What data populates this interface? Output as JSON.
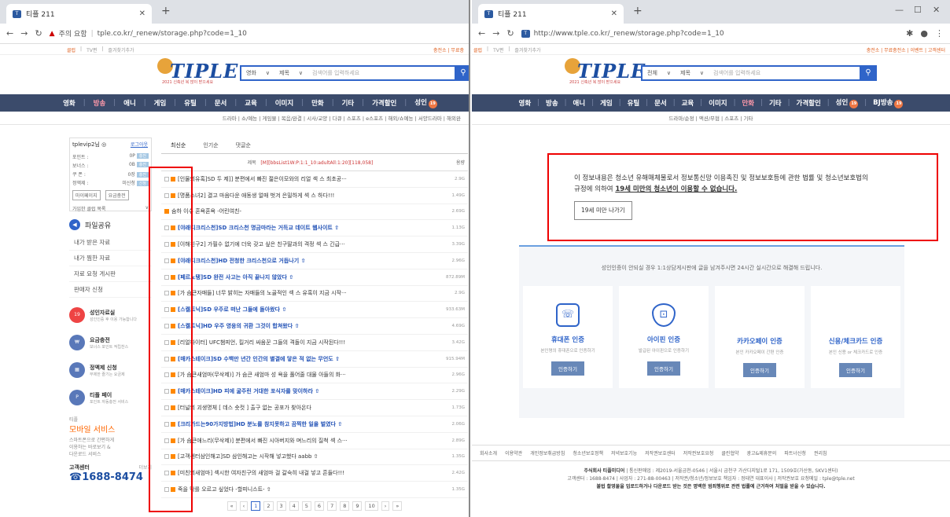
{
  "left_window": {
    "tab_title": "티플 211",
    "url_warning": "주의 요함",
    "url": "tple.co.kr/_renew/storage.php?code=1_10",
    "bookmarks": [
      "클럽",
      "TV편",
      "즐겨찾기추가"
    ],
    "bookmark_right": "충전소 | 무료충",
    "search": {
      "category": "영화",
      "field": "제목",
      "placeholder": "검색어를 입력하세요"
    },
    "logo_sub": "2021 신축년 복 많이 받으세요",
    "nav": [
      "영화",
      "방송",
      "애니",
      "게임",
      "유틸",
      "문서",
      "교육",
      "이미지",
      "만화",
      "기타",
      "가격할인",
      "성인"
    ],
    "subnav": "드라마 | 쇼/예능 | 게임물 | 목음/완결 | 시사/교양 | 다큐 | 스포츠 | e스포츠 | 해외/쇼예능 | 서양드라마 | 해외완",
    "user": {
      "name": "tplevip2님 ◎",
      "logout": "로그아웃",
      "rows": [
        [
          "포인트 :",
          "0P"
        ],
        [
          "보너스 :",
          "0B"
        ],
        [
          "쿠 폰 :",
          "0장"
        ],
        [
          "정액제 :",
          "미신청"
        ]
      ],
      "btn1": "마이페이지",
      "btn2": "요금충전",
      "dropdown": "가입한 클럽 목록"
    },
    "menu_title": "파일공유",
    "menu": [
      "내가 받은 자료",
      "내가 찜한 자료",
      "자료 요청 게시판",
      "판매자 신청"
    ],
    "promos": [
      {
        "t": "성인자료실",
        "s": "성인인증 후 이용 가능합니다"
      },
      {
        "t": "요금충전",
        "s": "보너스 포인트 적립찬스"
      },
      {
        "t": "정액제 신청",
        "s": "무제한 즐기는 요금제"
      },
      {
        "t": "티플 페이",
        "s": "포인트 자동충전 서비스"
      }
    ],
    "mobile": {
      "tag": "티플",
      "title": "모바일 서비스",
      "desc": "스마트폰으로 간편하게 이용하는 바로보기 & 다운로드 서비스"
    },
    "cs": "고객센터",
    "cs_more": "더보기",
    "tel": "1688-8474",
    "list_tabs": [
      "최신순",
      "인기순",
      "댓글순"
    ],
    "list_head": {
      "title": "제목",
      "debug": "[M][bbsList1W:P:1:1_10:adultAll:1:20][118,058]",
      "size": "용량"
    },
    "rows": [
      {
        "t": "[인물의유혹]SD 두 제]] 분편에서 빠진 젊은이모와의 리얼 섹 스 최초공···",
        "s": "2.9G",
        "b": false
      },
      {
        "t": "[명품소녀2] 결고 마음다운 애동생 얼매 벗겨 은밀하게 섹 스 하다!!!",
        "s": "1.49G",
        "b": false
      },
      {
        "t": "숨하 이수 혼욕혼욕 -어린여친-",
        "s": "2.69G",
        "b": false
      },
      {
        "t": "[야래디크리스천]SD 크리스천 명금마라는 거득교 데이트 웹사이트 ⇧",
        "s": "1.13G",
        "b": true
      },
      {
        "t": "[이해친구2] 가필수 없기에 더욱 갖고 싶은 친구딸과의 격정 섹 스 긴급···",
        "s": "3.39G",
        "b": false
      },
      {
        "t": "[야래디크리스천]HD 전청한 크리스천으로 거듭나기 ⇧",
        "s": "2.96G",
        "b": true
      },
      {
        "t": "[페르노탱]SD 완전 사고는 아직 끝나지 않았다 ⇧",
        "s": "872.89M",
        "b": true
      },
      {
        "t": "[가 슴큰자매들] 너무 밝히는 자매들의 노골적인 섹 스 유혹이 지금 시작···",
        "s": "2.9G",
        "b": false
      },
      {
        "t": "[스켈트닉]SD 우주로 떠난 그들에 돌아왔다 ⇧",
        "s": "933.63M",
        "b": true
      },
      {
        "t": "[스켈트닉]HD 우주 영웅의 귀환 그것이 합쳐왔다 ⇧",
        "s": "4.69G",
        "b": true
      },
      {
        "t": "[리얼파이터] UFC챔피언, 킬거리 싸움꾼 그들의 격돌이 지금 시작된다!!!",
        "s": "3.42G",
        "b": false
      },
      {
        "t": "[매카스테이크]SD 수백만 년간 인간의 별결에 닿은 적 없는 무언도 ⇧",
        "s": "915.94M",
        "b": true
      },
      {
        "t": "[가 슴큰새엄마(무삭제)] 가 슴큰 새엄마 성 욕을 풀어줄 대물 아들의 화···",
        "s": "2.96G",
        "b": false
      },
      {
        "t": "[매카스테이크]HD 피에 굶주린 거대한 포식자를 맞이하라 ⇧",
        "s": "2.29G",
        "b": true
      },
      {
        "t": "[터널의 괴생명체 [ 데스 숏컷 ] 출구 없는 공포가 찾아온다",
        "s": "1.73G",
        "b": false
      },
      {
        "t": "[크리가드는90가지방법]HD 분노를 참지못하고 끔찍한 일을 벌였다 ⇧",
        "s": "2.06G",
        "b": true
      },
      {
        "t": "[가 슴큰애느리(무삭제)] 분편에서 빠진 시아버지와 며느리의 질척 섹 스···",
        "s": "2.89G",
        "b": false
      },
      {
        "t": "[고객센터삼인해고]SD 삼인해고는 시작해 넣고했다 aabb ⇧",
        "s": "1.35G",
        "b": false
      },
      {
        "t": "[미친의새엄마] 섹시한 여자친구의 새엄마 걸 갈숙히 내걸 넣고 흔들다!!!",
        "s": "2.42G",
        "b": false
      },
      {
        "t": "죽을 막를 오르고 싶었다 -할피니스트- ⇧",
        "s": "1.35G",
        "b": false
      }
    ],
    "pages": [
      "«",
      "‹",
      "1",
      "2",
      "3",
      "4",
      "5",
      "6",
      "7",
      "8",
      "9",
      "10",
      "›",
      "»"
    ]
  },
  "right_window": {
    "tab_title": "티플 211",
    "url": "http://www.tple.co.kr/_renew/storage.php?code=1_10",
    "bookmarks": [
      "클럽",
      "TV편",
      "즐겨찾기추가"
    ],
    "bookmark_right": "충전소 | 무료충전소 | 이벤트 | 고객센터",
    "search": {
      "category": "전체",
      "field": "제목",
      "placeholder": "검색어를 입력하세요"
    },
    "logo_sub": "2021 신축년 복 많이 받으세요",
    "nav": [
      "영화",
      "방송",
      "애니",
      "게임",
      "유틸",
      "문서",
      "교육",
      "이미지",
      "만화",
      "기타",
      "가격할인",
      "성인",
      "BJ방송"
    ],
    "subnav": "드라마/순정 | 액션/무협 | 스포츠 | 기타",
    "notice_line1": "이 정보내용은 청소년 유해매체물로서 정보통신망 이용촉진 및 정보보호등에 관한 법률 및 청소년보호법의",
    "notice_line2_pre": "규정에 의하여 ",
    "notice_line2_u": "19세 미만의 청소년이 이용할 수 없습니다.",
    "notice_btn": "19세 미만 나가기",
    "cert_msg": "성인인증이 안되실 경우 1:1상담게시판에 글을 남겨주시면 24시간 실시간으로 해결해 드립니다.",
    "cards": [
      {
        "icon": "phone-icon",
        "glyph": "👤",
        "t": "휴대폰 인증",
        "s": "본인명의 휴대폰으로 인증하기",
        "b": "인증하기"
      },
      {
        "icon": "ipin-shield-icon",
        "glyph": "🔒",
        "t": "아이핀 인증",
        "s": "발급된 아이핀으로 인증하기",
        "b": "인증하기"
      },
      {
        "icon": "kakao-icon",
        "glyph": "",
        "t": "카카오페이 인증",
        "s": "본인 카카오페이 간편 인증",
        "b": "인증하기"
      },
      {
        "icon": "card-icon",
        "glyph": "",
        "t": "신용/체크카드 인증",
        "s": "본인 신용 or 체크카드로 인증",
        "b": "인증하기"
      }
    ],
    "footer_links": [
      "회사소개",
      "이용약관",
      "개인정보취급방침",
      "청소년보호정책",
      "저녁보호기능",
      "저작권보호센터",
      "저작권보호요청",
      "클린협약",
      "광고&제휴문의",
      "파트너신청",
      "권리침"
    ],
    "footer_co": "주식회사 티플미디어",
    "footer_addr": " | 통신판매업 : 제2019-서울금천-0546 | 서울시 금천구 가산디지털1로 171, 1509호(가산동, SKV1센터)",
    "footer_line2": "고객센터 : 1688-8474 | 사업자 : 271-88-00463 | 저작권/청소년/정보보호 책임자 : 정태연 대표이사 | 저작권보호 요청메일 : tple@tple.net",
    "footer_warn": "불법 촬영물을 업로드하거나 다운로드 받는 것은 명백한 범죄행위로 관련 법률에 근거하여 처벌을 받을 수 있습니다."
  },
  "colors": {
    "accent": "#2f64c9",
    "nav_bg": "#3b4b6b",
    "highlight": "#e00000"
  }
}
